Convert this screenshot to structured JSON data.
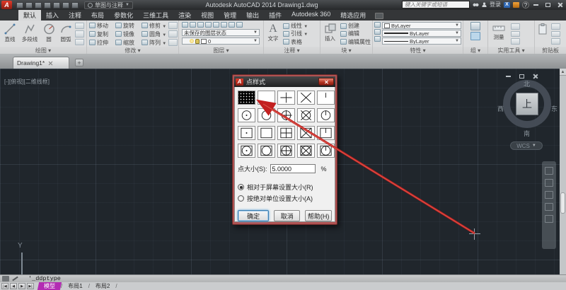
{
  "titlebar": {
    "logo_letter": "A",
    "workspace": "草图与注释",
    "app_title": "Autodesk AutoCAD 2014   Drawing1.dwg",
    "search_placeholder": "键入关键字或短语",
    "signin_label": "登录",
    "exchange_badge": "X",
    "help_badge": "?"
  },
  "ribbon": {
    "tabs": [
      "默认",
      "插入",
      "注释",
      "布局",
      "参数化",
      "三维工具",
      "渲染",
      "视图",
      "管理",
      "输出",
      "插件",
      "Autodesk 360",
      "精选应用"
    ],
    "active_tab_index": 0,
    "draw": {
      "label": "绘图",
      "items": [
        "直线",
        "多段线",
        "圆",
        "圆弧"
      ]
    },
    "modify": {
      "label": "修改",
      "items": [
        "移动",
        "旋转",
        "修剪",
        "复制",
        "镜像",
        "圆角",
        "拉伸",
        "缩放",
        "阵列"
      ]
    },
    "layers": {
      "label": "图层",
      "state_dropdown": "未保存的图层状态",
      "layer_name": "0"
    },
    "annotation": {
      "label": "注释",
      "big_icon_letter": "A",
      "big_label": "文字",
      "items": [
        "线性",
        "引线",
        "表格"
      ]
    },
    "block": {
      "label": "块",
      "big_label": "插入",
      "items": [
        "创建",
        "编辑",
        "编辑属性"
      ]
    },
    "properties": {
      "label": "特性",
      "rows": [
        "ByLayer",
        "ByLayer",
        "ByLayer"
      ]
    },
    "group": {
      "label": "组"
    },
    "utilities": {
      "label": "实用工具",
      "big_label": "测量"
    },
    "clipboard": {
      "label": "剪贴板"
    }
  },
  "file_tabs": {
    "name": "Drawing1*",
    "new_tab": "+"
  },
  "canvas": {
    "viewport_label": "[-][俯视][二维线框]",
    "ucs_axis": "Y",
    "viewcube": {
      "north": "北",
      "south": "南",
      "east": "东",
      "west": "西",
      "top": "上",
      "wcs": "WCS"
    }
  },
  "dialog": {
    "title": "点样式",
    "grid": [
      "dot",
      "blank",
      "plus",
      "cross",
      "tick",
      "circle-dot",
      "circle",
      "circle-plus",
      "circle-cross",
      "circle-tick",
      "square-dot",
      "square",
      "square-plus",
      "square-cross",
      "square-tick",
      "square-circle-dot",
      "square-circle",
      "square-circle-plus",
      "square-circle-cross",
      "square-circle-tick"
    ],
    "selected_index": 0,
    "size_label": "点大小(S):",
    "size_value": "5.0000",
    "size_unit": "%",
    "radios": [
      {
        "label": "相对于屏幕设置大小(R)",
        "checked": true
      },
      {
        "label": "按绝对单位设置大小(A)",
        "checked": false
      }
    ],
    "buttons": {
      "ok": "确定",
      "cancel": "取消",
      "help": "帮助(H)"
    }
  },
  "statusbar": {
    "command_text": "'_ddptype",
    "nav_icons": [
      "|◀",
      "◀",
      "▶",
      "▶|"
    ],
    "layout_tabs": [
      "模型",
      "布局1",
      "布局2"
    ],
    "active_layout": "模型",
    "tab_separator": "/"
  },
  "colors": {
    "accent_red": "#c2201f",
    "arrow_red": "#c32020",
    "model_tab_magenta": "#b32bb3",
    "canvas_bg": "#20262c",
    "dialog_frame": "#b05252",
    "focus_blue": "#3c7fb1"
  }
}
